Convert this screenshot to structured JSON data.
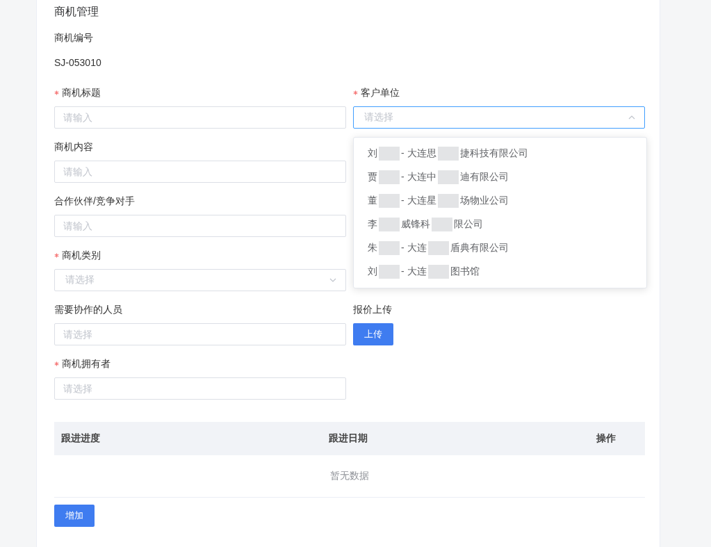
{
  "section_title": "商机管理",
  "number": {
    "label": "商机编号",
    "value": "SJ-053010"
  },
  "rows": [
    {
      "left": {
        "label": "商机标题",
        "required": true,
        "kind": "input",
        "placeholder": "请输入"
      },
      "right": {
        "label": "客户单位",
        "required": true,
        "kind": "select",
        "placeholder": "请选择",
        "expanded": true,
        "options": [
          {
            "parts": [
              "刘",
              "- 大连思",
              "捷科技有限公司"
            ]
          },
          {
            "parts": [
              "贾",
              "- 大连中",
              "迪有限公司"
            ]
          },
          {
            "parts": [
              "董",
              "- 大连星",
              "场物业公司"
            ]
          },
          {
            "parts": [
              "李",
              "威锋科",
              "限公司"
            ]
          },
          {
            "parts": [
              "朱",
              "- 大连",
              "盾典有限公司"
            ]
          },
          {
            "parts": [
              "刘",
              "- 大连",
              "图书馆"
            ]
          }
        ]
      }
    },
    {
      "left": {
        "label": "商机内容",
        "required": false,
        "kind": "input",
        "placeholder": "请输入"
      }
    },
    {
      "left": {
        "label": "合作伙伴/竞争对手",
        "required": false,
        "kind": "input",
        "placeholder": "请输入"
      }
    },
    {
      "left": {
        "label": "商机类别",
        "required": true,
        "kind": "select",
        "placeholder": "请选择",
        "expanded": false
      }
    },
    {
      "left": {
        "label": "需要协作的人员",
        "required": false,
        "kind": "input",
        "placeholder": "请选择"
      },
      "right": {
        "label": "报价上传",
        "required": false,
        "kind": "upload",
        "button": "上传"
      }
    },
    {
      "left": {
        "label": "商机拥有者",
        "required": true,
        "kind": "input",
        "placeholder": "请选择"
      }
    }
  ],
  "table": {
    "columns": [
      "跟进进度",
      "跟进日期",
      "操作"
    ],
    "empty_text": "暂无数据"
  },
  "add_button": "增加"
}
